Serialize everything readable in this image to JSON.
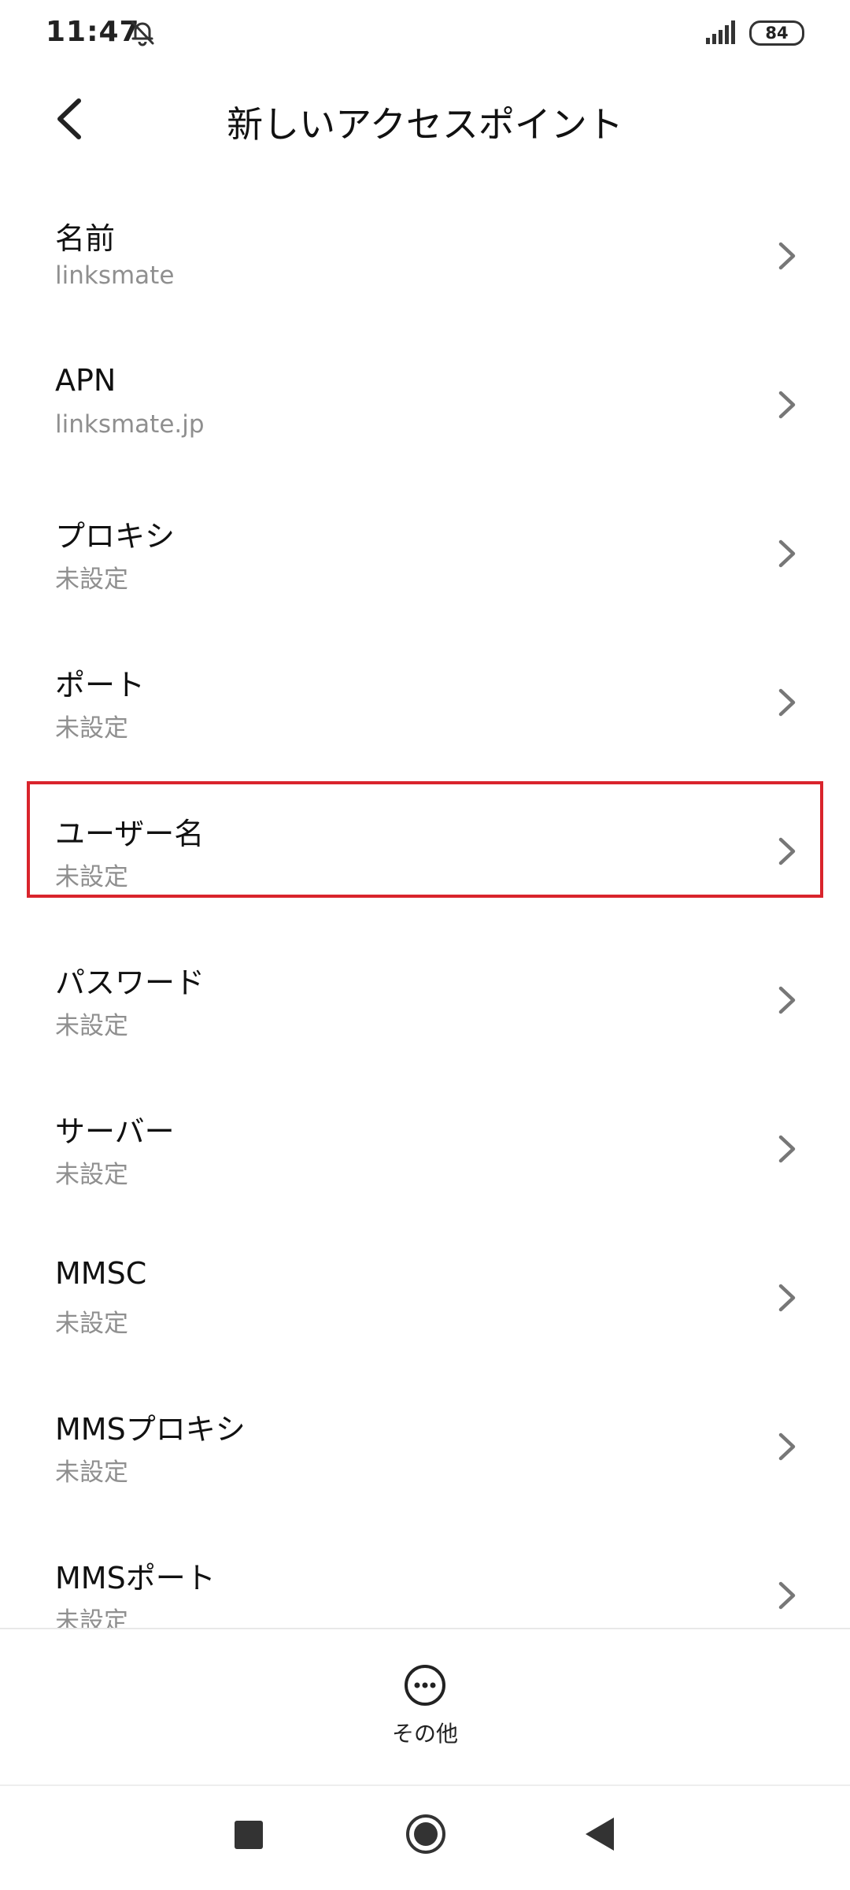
{
  "status_bar": {
    "time": "11:47",
    "icons": [
      "bell-off-icon",
      "signal-icon",
      "battery-icon"
    ],
    "battery_level": "84"
  },
  "header": {
    "back_icon": "chevron-left-icon",
    "title": "新しいアクセスポイント"
  },
  "apn_settings": {
    "items": [
      {
        "id": "name",
        "label": "名前",
        "value": "linksmate"
      },
      {
        "id": "apn",
        "label": "APN",
        "value": "linksmate.jp"
      },
      {
        "id": "proxy",
        "label": "プロキシ",
        "value": "未設定"
      },
      {
        "id": "port",
        "label": "ポート",
        "value": "未設定"
      },
      {
        "id": "username",
        "label": "ユーザー名",
        "value": "未設定",
        "highlighted": true
      },
      {
        "id": "password",
        "label": "パスワード",
        "value": "未設定"
      },
      {
        "id": "server",
        "label": "サーバー",
        "value": "未設定"
      },
      {
        "id": "mmsc",
        "label": "MMSC",
        "value": "未設定"
      },
      {
        "id": "mms-proxy",
        "label": "MMSプロキシ",
        "value": "未設定"
      },
      {
        "id": "mms-port",
        "label": "MMSポート",
        "value": "未設定"
      }
    ]
  },
  "bottom_action": {
    "icon": "more-horizontal-icon",
    "label": "その他"
  },
  "nav_bar": {
    "icons": [
      "recents-square-icon",
      "home-circle-icon",
      "back-triangle-icon"
    ]
  },
  "colors": {
    "highlight": "#d9242c",
    "value_text": "#8f8f8f",
    "chevron": "#777777"
  }
}
